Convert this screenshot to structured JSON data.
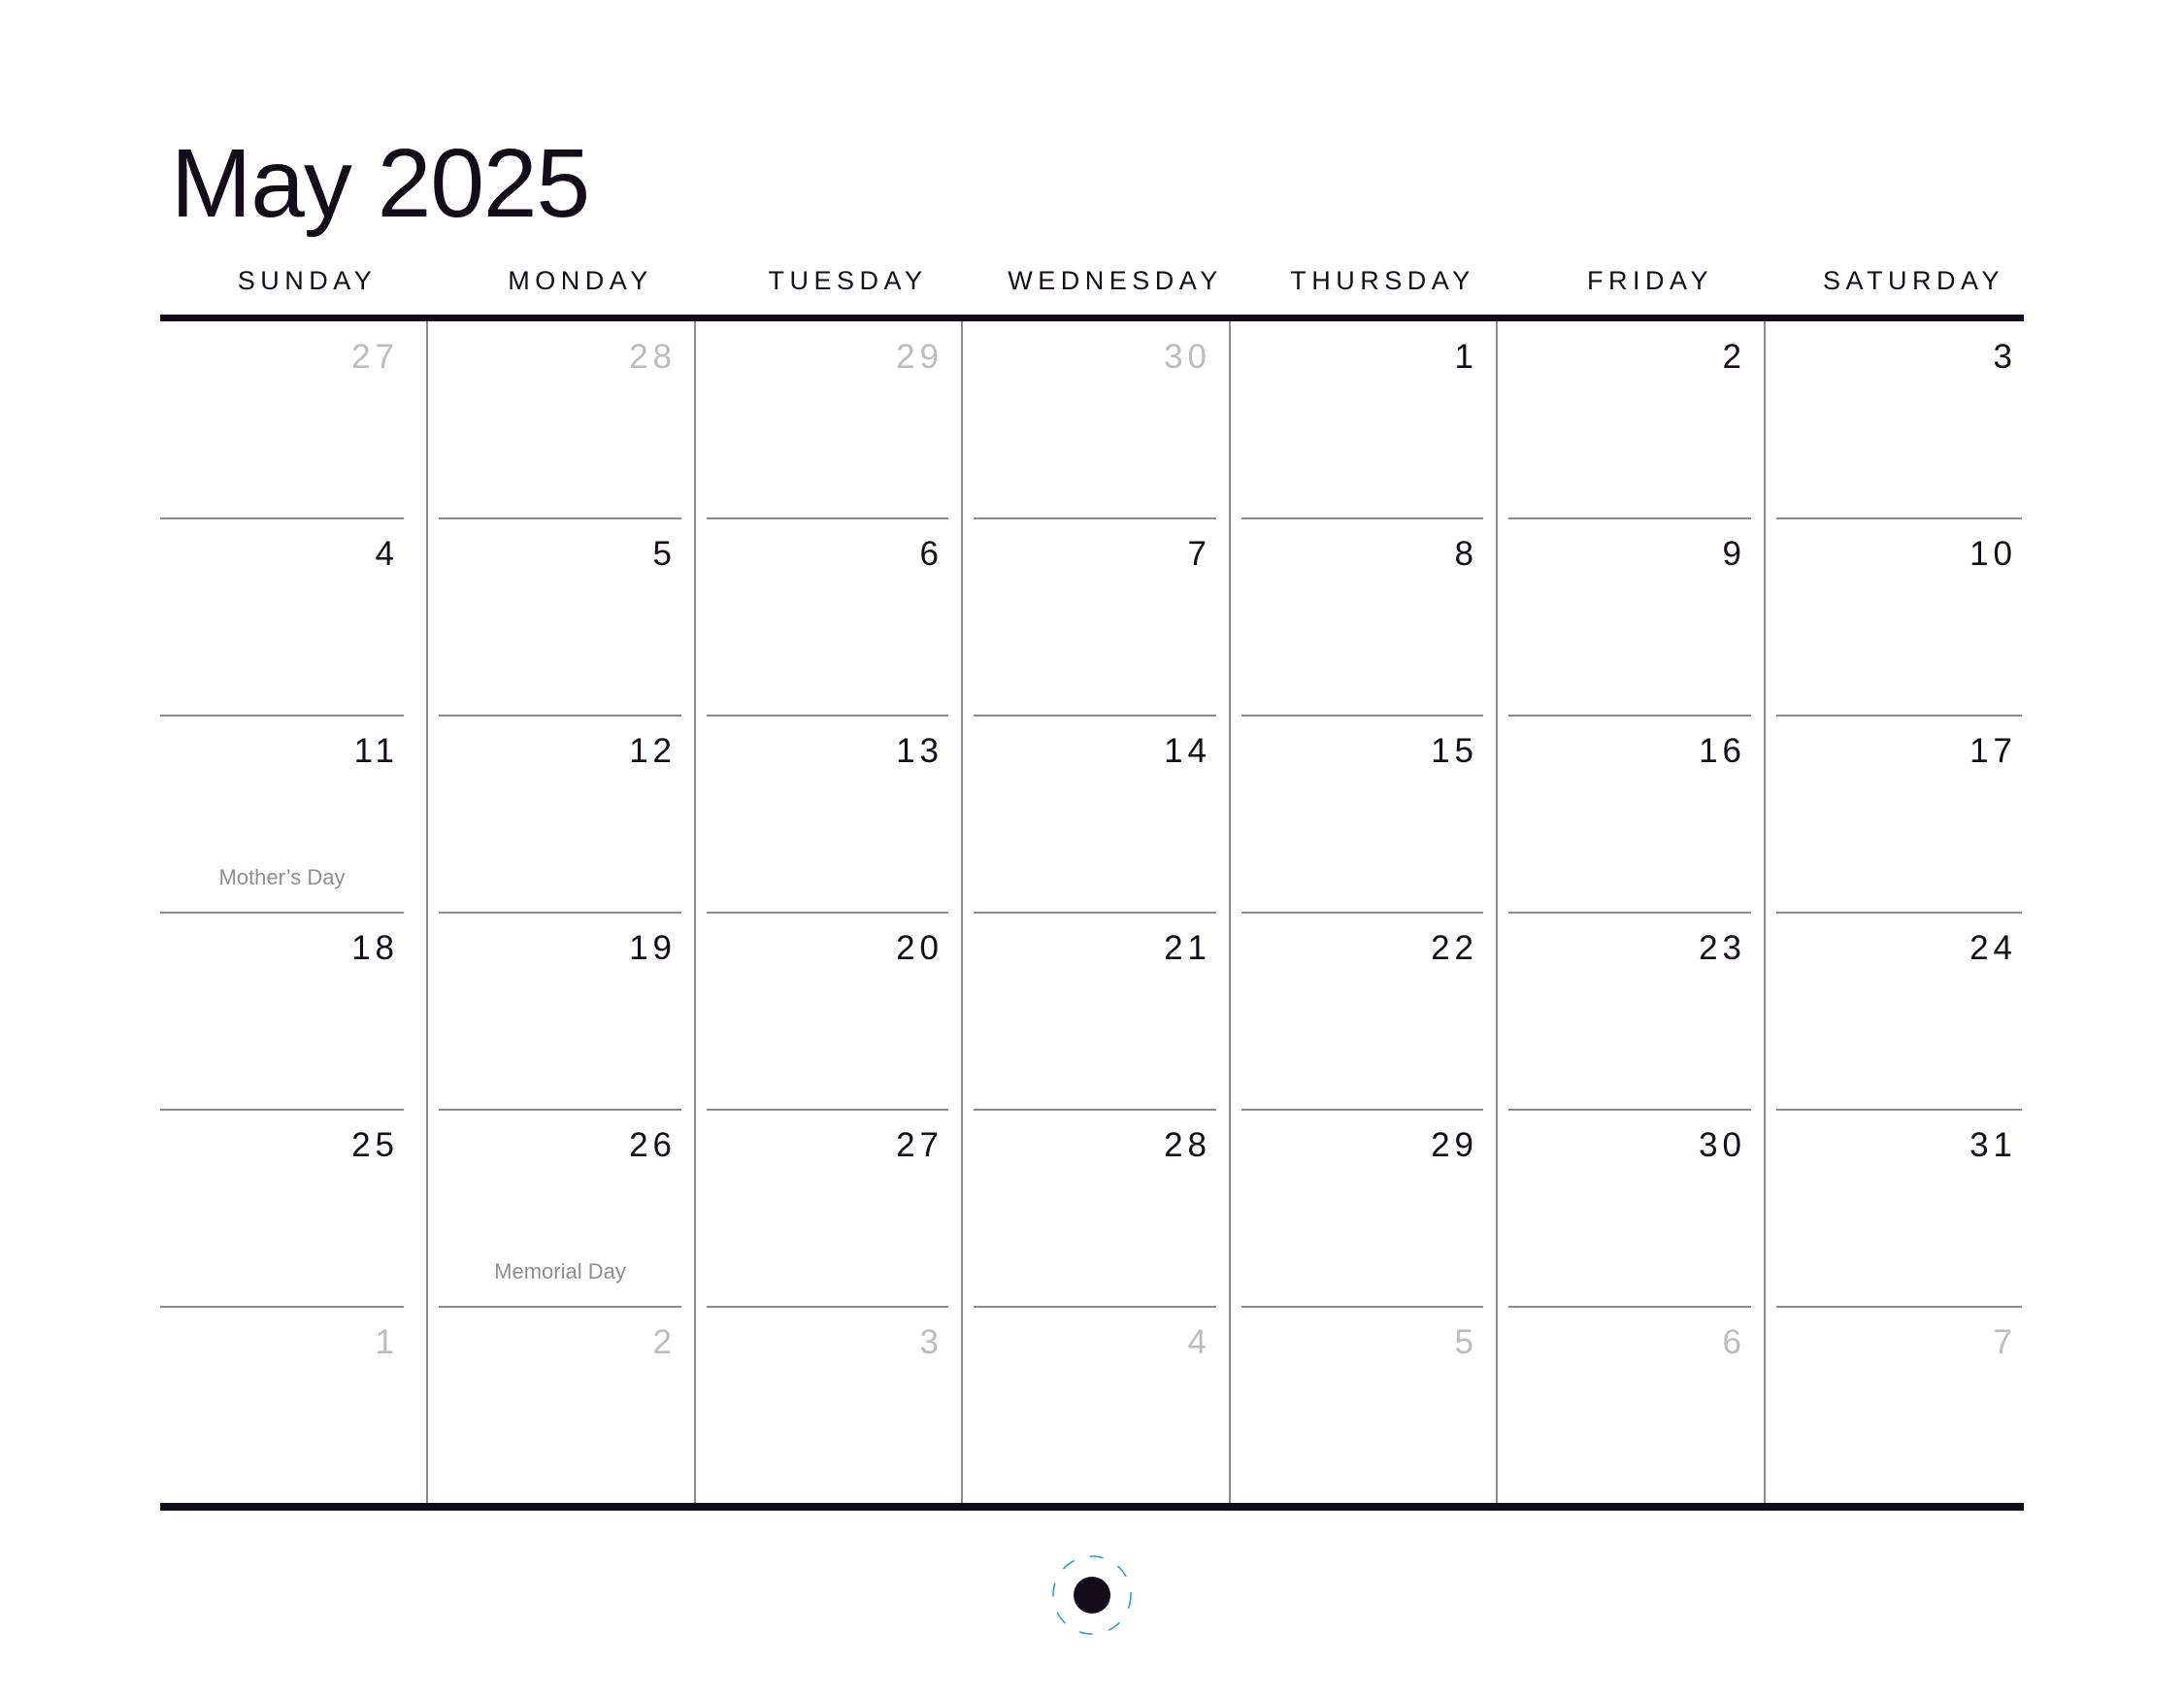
{
  "calendar": {
    "title": "May 2025",
    "weekdays": [
      "SUNDAY",
      "MONDAY",
      "TUESDAY",
      "WEDNESDAY",
      "THURSDAY",
      "FRIDAY",
      "SATURDAY"
    ],
    "weeks": [
      [
        {
          "day": "27",
          "muted": true
        },
        {
          "day": "28",
          "muted": true
        },
        {
          "day": "29",
          "muted": true
        },
        {
          "day": "30",
          "muted": true
        },
        {
          "day": "1"
        },
        {
          "day": "2"
        },
        {
          "day": "3"
        }
      ],
      [
        {
          "day": "4"
        },
        {
          "day": "5"
        },
        {
          "day": "6"
        },
        {
          "day": "7"
        },
        {
          "day": "8"
        },
        {
          "day": "9"
        },
        {
          "day": "10"
        }
      ],
      [
        {
          "day": "11",
          "holiday": "Mother’s Day"
        },
        {
          "day": "12"
        },
        {
          "day": "13"
        },
        {
          "day": "14"
        },
        {
          "day": "15"
        },
        {
          "day": "16"
        },
        {
          "day": "17"
        }
      ],
      [
        {
          "day": "18"
        },
        {
          "day": "19"
        },
        {
          "day": "20"
        },
        {
          "day": "21"
        },
        {
          "day": "22"
        },
        {
          "day": "23"
        },
        {
          "day": "24"
        }
      ],
      [
        {
          "day": "25"
        },
        {
          "day": "26",
          "holiday": "Memorial Day"
        },
        {
          "day": "27"
        },
        {
          "day": "28"
        },
        {
          "day": "29"
        },
        {
          "day": "30"
        },
        {
          "day": "31"
        }
      ],
      [
        {
          "day": "1",
          "muted": true
        },
        {
          "day": "2",
          "muted": true
        },
        {
          "day": "3",
          "muted": true
        },
        {
          "day": "4",
          "muted": true
        },
        {
          "day": "5",
          "muted": true
        },
        {
          "day": "6",
          "muted": true
        },
        {
          "day": "7",
          "muted": true
        }
      ]
    ]
  },
  "binding_hole": {
    "icon": "punch-hole-icon"
  },
  "colors": {
    "ink": "#140c1a",
    "muted_day": "#bcbcbc",
    "grid_line": "#8c8c8c",
    "holiday_text": "#8e8e8e",
    "hole_guide": "#2a9fd6"
  }
}
